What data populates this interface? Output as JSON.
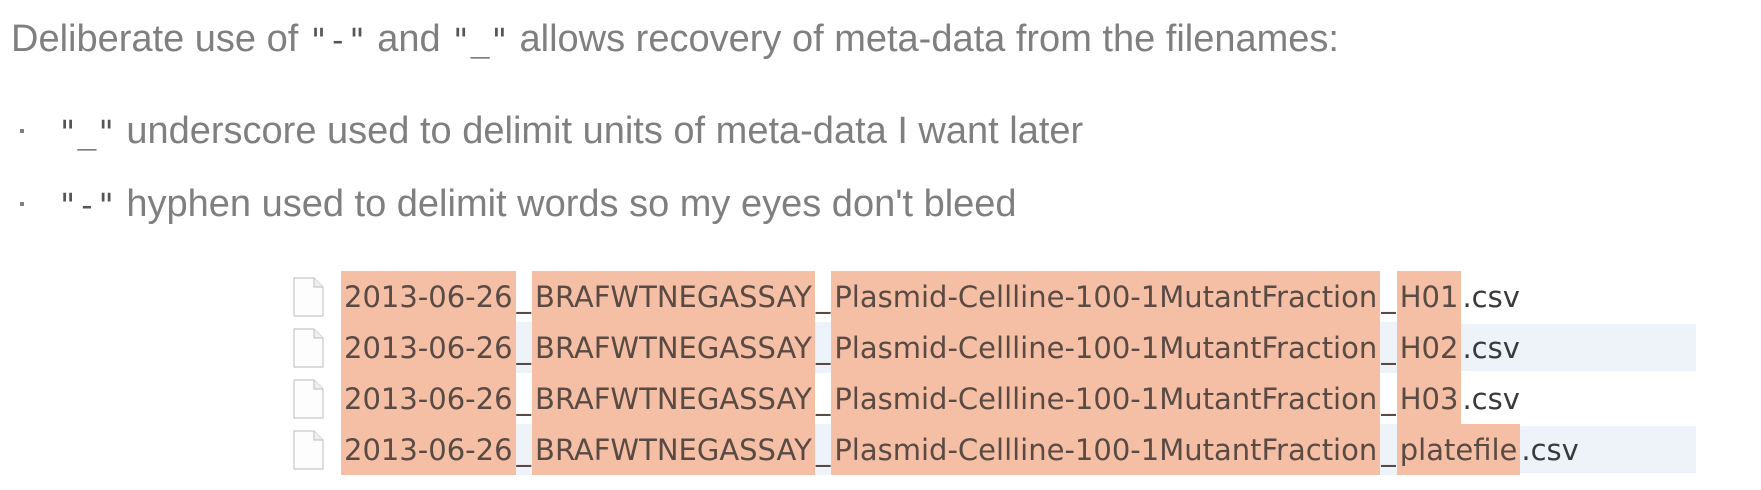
{
  "intro": {
    "before": "Deliberate use of ",
    "hyphen_code": "\"-\"",
    "middle": " and ",
    "underscore_code": "\"_\"",
    "after": " allows recovery of meta-data from the filenames:"
  },
  "bullets": [
    {
      "code": "\"_\"",
      "text": " underscore used to delimit units of meta-data I want later"
    },
    {
      "code": "\"-\"",
      "text": " hyphen used to delimit words so my eyes don't bleed"
    }
  ],
  "files": [
    {
      "date": "2013-06-26",
      "assay": "BRAFWTNEGASSAY",
      "condition": "Plasmid-Cellline-100-1MutantFraction",
      "well": "H01",
      "ext": ".csv"
    },
    {
      "date": "2013-06-26",
      "assay": "BRAFWTNEGASSAY",
      "condition": "Plasmid-Cellline-100-1MutantFraction",
      "well": "H02",
      "ext": ".csv"
    },
    {
      "date": "2013-06-26",
      "assay": "BRAFWTNEGASSAY",
      "condition": "Plasmid-Cellline-100-1MutantFraction",
      "well": "H03",
      "ext": ".csv"
    },
    {
      "date": "2013-06-26",
      "assay": "BRAFWTNEGASSAY",
      "condition": "Plasmid-Cellline-100-1MutantFraction",
      "well": "platefile",
      "ext": ".csv"
    }
  ],
  "separator": "_",
  "colors": {
    "highlight": "#f5bfa6",
    "alt_row": "#eef3f9",
    "body_text": "#7f7f7f"
  },
  "icons": {
    "file": "document-icon"
  }
}
